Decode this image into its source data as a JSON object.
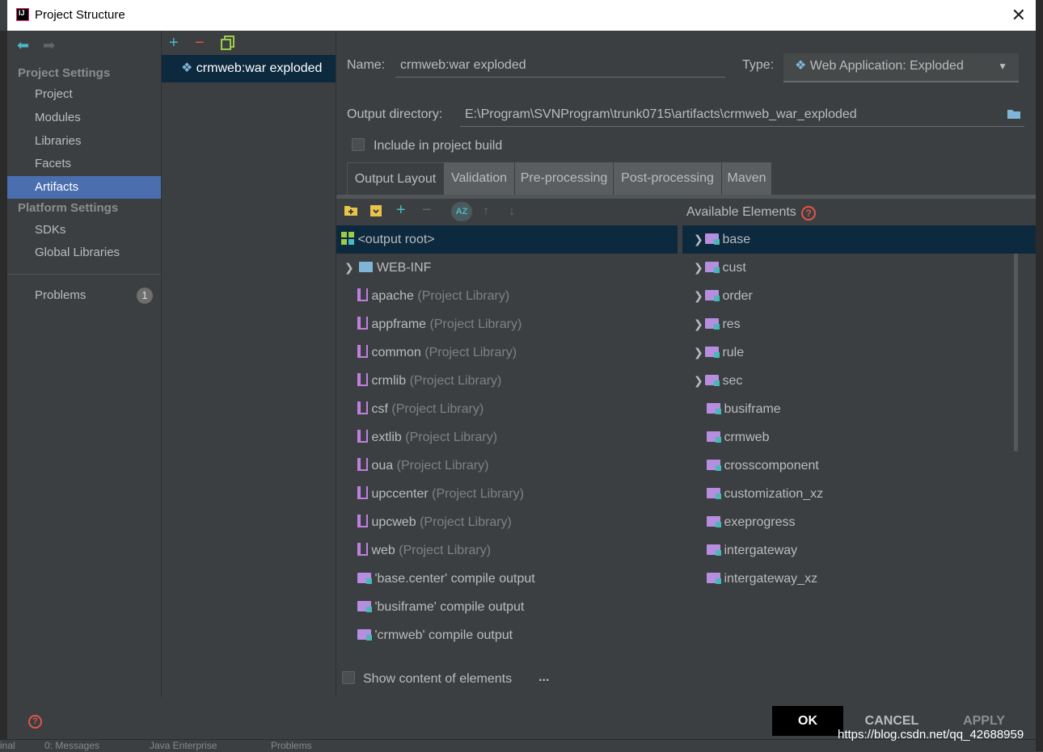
{
  "window": {
    "title": "Project Structure"
  },
  "sidebar": {
    "project_settings": "Project Settings",
    "items": [
      "Project",
      "Modules",
      "Libraries",
      "Facets",
      "Artifacts"
    ],
    "platform_settings": "Platform Settings",
    "platform_items": [
      "SDKs",
      "Global Libraries"
    ],
    "problems": "Problems",
    "problems_count": "1"
  },
  "artifacts": {
    "selected": "crmweb:war exploded"
  },
  "form": {
    "name_label": "Name:",
    "name_value": "crmweb:war exploded",
    "type_label": "Type:",
    "type_value": "Web Application: Exploded",
    "output_label": "Output directory:",
    "output_value": "E:\\Program\\SVNProgram\\trunk0715\\artifacts\\crmweb_war_exploded",
    "include_build": "Include in project build",
    "show_content": "Show content of elements",
    "more": "..."
  },
  "tabs": [
    "Output Layout",
    "Validation",
    "Pre-processing",
    "Post-processing",
    "Maven"
  ],
  "available_title": "Available Elements",
  "output_tree": [
    {
      "name": "<output root>",
      "extra": ""
    },
    {
      "name": "WEB-INF",
      "extra": ""
    },
    {
      "name": "apache",
      "extra": "(Project Library)"
    },
    {
      "name": "appframe",
      "extra": "(Project Library)"
    },
    {
      "name": "common",
      "extra": "(Project Library)"
    },
    {
      "name": "crmlib",
      "extra": "(Project Library)"
    },
    {
      "name": "csf",
      "extra": "(Project Library)"
    },
    {
      "name": "extlib",
      "extra": "(Project Library)"
    },
    {
      "name": "oua",
      "extra": "(Project Library)"
    },
    {
      "name": "upccenter",
      "extra": "(Project Library)"
    },
    {
      "name": "upcweb",
      "extra": "(Project Library)"
    },
    {
      "name": "web",
      "extra": "(Project Library)"
    },
    {
      "name": "'base.center' compile output",
      "extra": ""
    },
    {
      "name": "'busiframe' compile output",
      "extra": ""
    },
    {
      "name": "'crmweb' compile output",
      "extra": ""
    }
  ],
  "available": [
    "base",
    "cust",
    "order",
    "res",
    "rule",
    "sec",
    "busiframe",
    "crmweb",
    "crosscomponent",
    "customization_xz",
    "exeprogress",
    "intergateway",
    "intergateway_xz"
  ],
  "footer": {
    "ok": "OK",
    "cancel": "CANCEL",
    "apply": "APPLY"
  },
  "background": {
    "tabs": [
      "0: Messages",
      "Java Enterprise",
      "Problems"
    ],
    "left": "inal"
  },
  "watermark": "https://blog.csdn.net/qq_42688959"
}
